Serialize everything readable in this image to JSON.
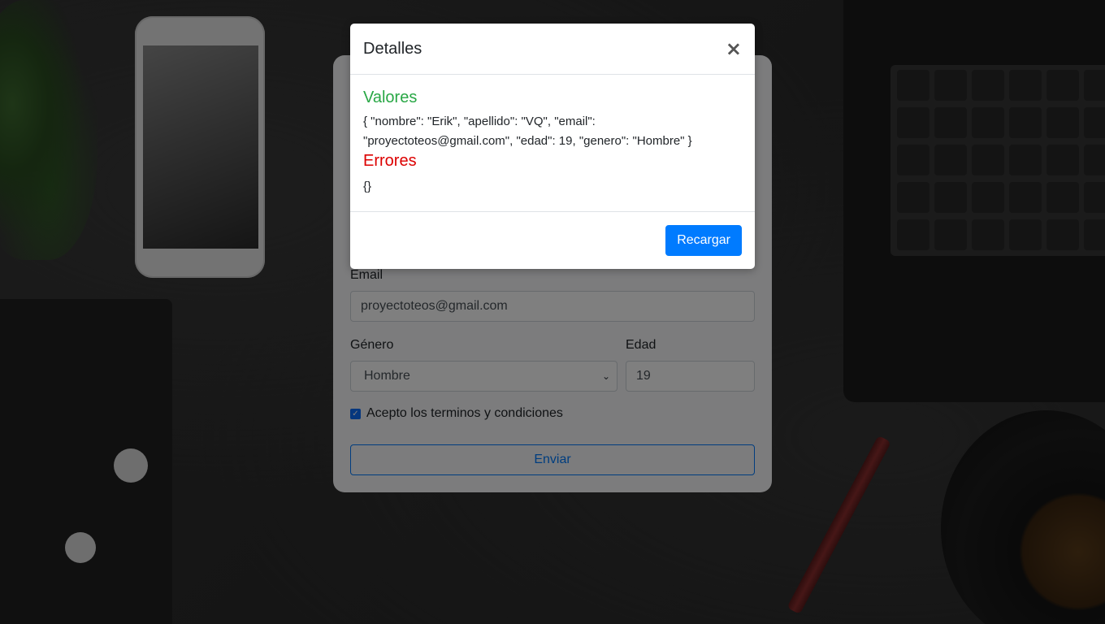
{
  "modal": {
    "title": "Detalles",
    "close_label": "×",
    "values_heading": "Valores",
    "values_json": "{ \"nombre\": \"Erik\", \"apellido\": \"VQ\", \"email\": \"proyectoteos@gmail.com\", \"edad\": 19, \"genero\": \"Hombre\" }",
    "errors_heading": "Errores",
    "errors_json": "{}",
    "reload_label": "Recargar"
  },
  "form": {
    "email_label": "Email",
    "email_value": "proyectoteos@gmail.com",
    "gender_label": "Género",
    "gender_value": "Hombre",
    "age_label": "Edad",
    "age_value": "19",
    "terms_label": "Acepto los terminos y condiciones",
    "terms_checked": true,
    "submit_label": "Enviar"
  },
  "icons": {
    "close": "close-icon",
    "select_chevron": "chevron-down-icon",
    "checkbox": "check-icon"
  },
  "colors": {
    "primary": "#007bff",
    "success_heading": "#28a745",
    "error_heading": "#dc0000"
  }
}
